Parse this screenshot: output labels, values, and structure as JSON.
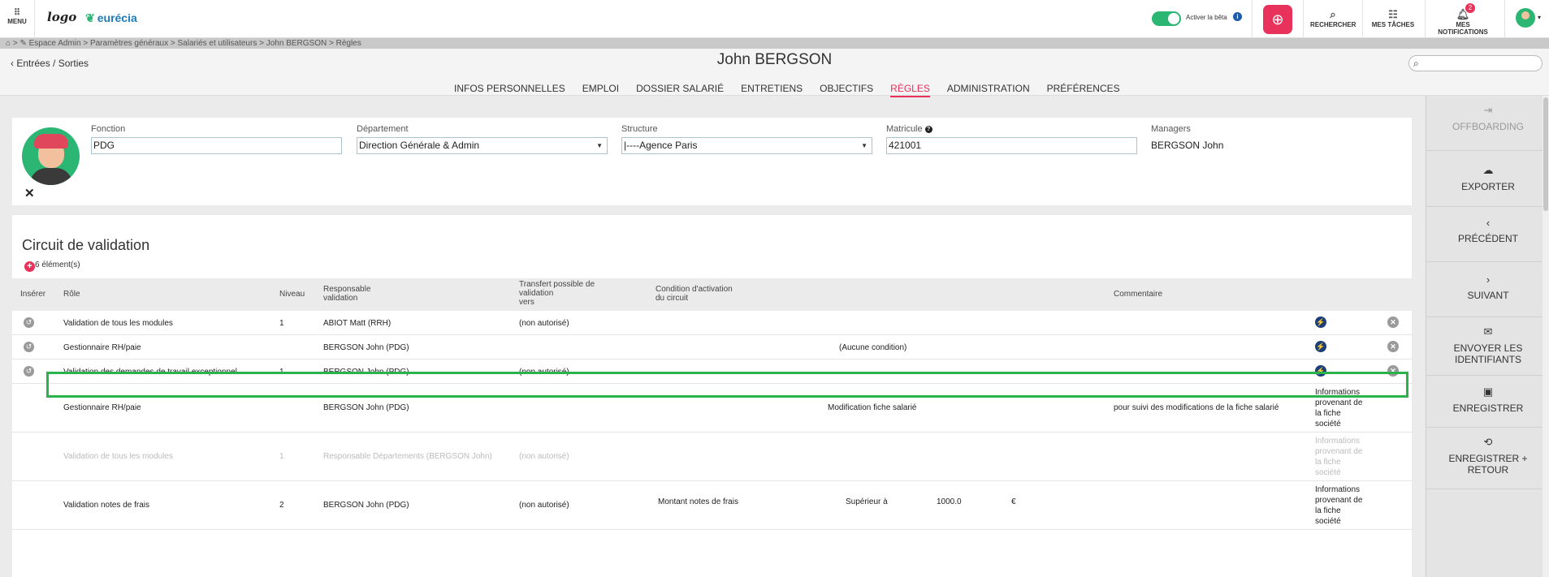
{
  "topbar": {
    "menu_label": "MENU",
    "logo_text": "logo",
    "brand_name": "eurécia",
    "beta_label": "Activer la bêta",
    "search_label": "RECHERCHER",
    "tasks_label": "MES TÂCHES",
    "notifications_label": "MES NOTIFICATIONS",
    "notifications_count": "2",
    "accent_color": "#e8315b",
    "toggle_color": "#2bb673"
  },
  "breadcrumb": "Espace Admin > Paramètres généraux > Salariés et utilisateurs > John BERGSON > Règles",
  "header": {
    "back_label": "Entrées / Sorties",
    "title": "John BERGSON",
    "search_placeholder": ""
  },
  "tabs": [
    {
      "label": "INFOS PERSONNELLES",
      "active": false
    },
    {
      "label": "EMPLOI",
      "active": false
    },
    {
      "label": "DOSSIER SALARIÉ",
      "active": false
    },
    {
      "label": "ENTRETIENS",
      "active": false
    },
    {
      "label": "OBJECTIFS",
      "active": false
    },
    {
      "label": "RÈGLES",
      "active": true
    },
    {
      "label": "ADMINISTRATION",
      "active": false
    },
    {
      "label": "PRÉFÉRENCES",
      "active": false
    }
  ],
  "profile": {
    "fonction_label": "Fonction",
    "fonction_value": "PDG",
    "departement_label": "Département",
    "departement_value": "Direction Générale & Admin",
    "structure_label": "Structure",
    "structure_value": "|----Agence Paris",
    "matricule_label": "Matricule",
    "matricule_value": "421001",
    "managers_label": "Managers",
    "managers_value": "BERGSON John",
    "remove_symbol": "✕"
  },
  "circuit": {
    "title": "Circuit de validation",
    "count_text": "6 élément(s)",
    "headers": {
      "inserer": "Insérer",
      "role": "Rôle",
      "niveau": "Niveau",
      "responsable_1": "Responsable",
      "responsable_2": "validation",
      "transfert_1": "Transfert possible de",
      "transfert_2": "validation",
      "transfert_3": "vers",
      "condition_1": "Condition d'activation",
      "condition_2": "du circuit",
      "commentaire": "Commentaire"
    },
    "rows": [
      {
        "role": "Validation de tous les modules",
        "niveau": "1",
        "responsable": "ABIOT Matt (RRH)",
        "transfert": "(non autorisé)",
        "condition": "",
        "commentaire": "",
        "extra": ""
      },
      {
        "role": "Gestionnaire RH/paie",
        "niveau": "",
        "responsable": "BERGSON John (PDG)",
        "transfert": "",
        "condition": "(Aucune condition)",
        "commentaire": "",
        "extra": ""
      },
      {
        "role": "Validation des demandes de travail exceptionnel",
        "niveau": "1",
        "responsable": "BERGSON John (PDG)",
        "transfert": "(non autorisé)",
        "condition": "",
        "commentaire": "",
        "extra": ""
      },
      {
        "role": "Gestionnaire RH/paie",
        "niveau": "",
        "responsable": "BERGSON John (PDG)",
        "transfert": "",
        "condition": "Modification fiche salarié",
        "commentaire": "pour suivi des modifications de la fiche salarié",
        "extra_1": "Informations",
        "extra_2": "provenant de",
        "extra_3": "la fiche",
        "extra_4": "société"
      },
      {
        "role": "Validation de tous les modules",
        "niveau": "1",
        "responsable": "Responsable Départements (BERGSON John)",
        "transfert": "(non autorisé)",
        "condition": "",
        "commentaire": "",
        "extra_1": "Informations",
        "extra_2": "provenant de",
        "extra_3": "la fiche",
        "extra_4": "société"
      },
      {
        "role": "Validation notes de frais",
        "niveau": "2",
        "responsable": "BERGSON John (PDG)",
        "transfert": "(non autorisé)",
        "condition": "Montant notes de frais",
        "operator": "Supérieur à",
        "amount": "1000.0",
        "currency": "€",
        "extra_1": "Informations",
        "extra_2": "provenant de",
        "extra_3": "la fiche",
        "extra_4": "société"
      }
    ]
  },
  "side_actions": [
    {
      "label": "OFFBOARDING",
      "icon": "sign-out-icon",
      "enabled": false
    },
    {
      "label": "EXPORTER",
      "icon": "cloud-upload-icon",
      "enabled": true
    },
    {
      "label": "PRÉCÉDENT",
      "icon": "chevron-left-icon",
      "enabled": true
    },
    {
      "label": "SUIVANT",
      "icon": "chevron-right-icon",
      "enabled": true
    },
    {
      "label_1": "ENVOYER LES",
      "label_2": "IDENTIFIANTS",
      "icon": "envelope-icon",
      "enabled": true
    },
    {
      "label": "ENREGISTRER",
      "icon": "save-icon",
      "enabled": true
    },
    {
      "label_1": "ENREGISTRER +",
      "label_2": "RETOUR",
      "icon": "save-return-icon",
      "enabled": true
    }
  ]
}
